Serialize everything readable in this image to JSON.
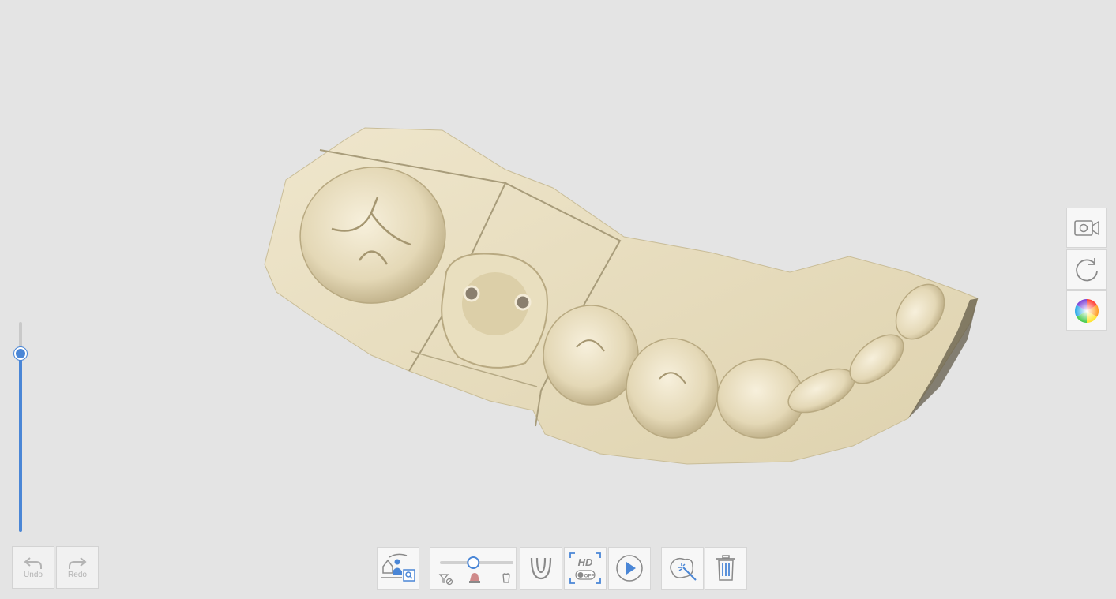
{
  "colors": {
    "background": "#e4e4e4",
    "accent": "#4a86d6",
    "model_base": "#e9e0c4",
    "icon_gray": "#8a8a8a",
    "disabled": "#b4b4b4"
  },
  "history": {
    "undo_label": "Undo",
    "redo_label": "Redo",
    "enabled": false
  },
  "opacity_slider": {
    "level": 0.85
  },
  "toolbar": {
    "filter_slider": {
      "level": 0.45
    },
    "hd_label": "HD",
    "hd_state": "OFF",
    "items": [
      "scan-filter-icon",
      "filter-level-slider",
      "arch-icon",
      "hd-toggle-icon",
      "play-icon",
      "lasso-erase-icon",
      "trash-icon"
    ]
  },
  "side_tools": [
    "video-camera-icon",
    "reset-view-icon",
    "color-wheel-icon"
  ]
}
